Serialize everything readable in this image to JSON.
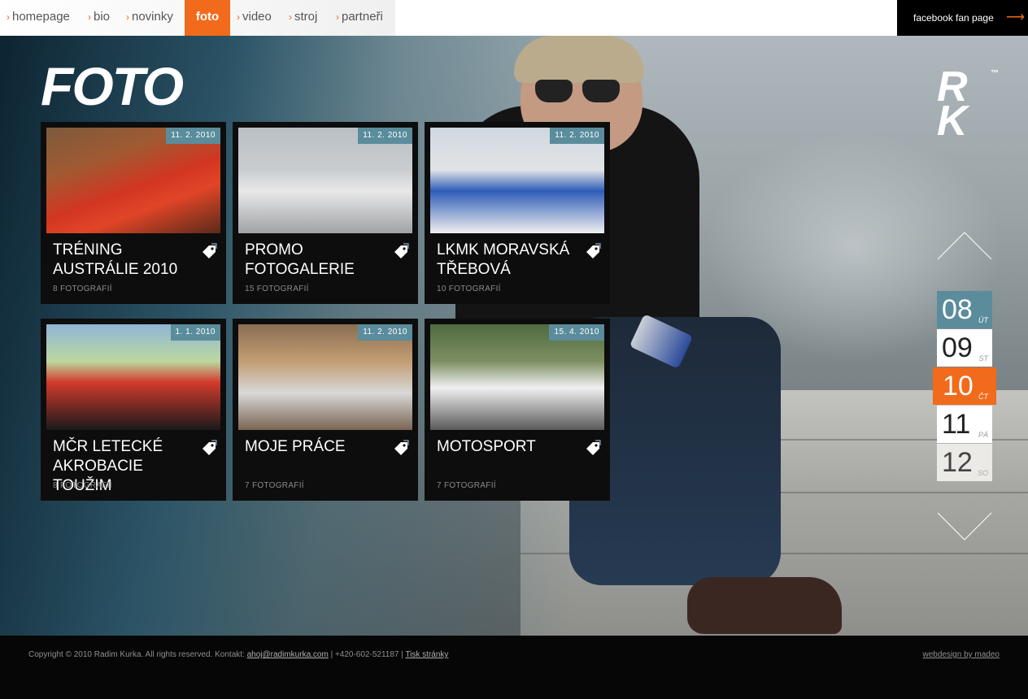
{
  "nav": {
    "items": [
      {
        "label": "homepage",
        "active": false
      },
      {
        "label": "bio",
        "active": false
      },
      {
        "label": "novinky",
        "active": false
      },
      {
        "label": "foto",
        "active": true
      },
      {
        "label": "video",
        "active": false
      },
      {
        "label": "stroj",
        "active": false
      },
      {
        "label": "partneři",
        "active": false
      }
    ],
    "arrow_glyph": "›",
    "facebook_label": "facebook fan page",
    "facebook_icon": "arrow-right-icon"
  },
  "page": {
    "title": "FOTO",
    "logo": "RK",
    "logo_tm": "™"
  },
  "colors": {
    "accent": "#f26a1b",
    "date_badge": "#5a8c9c",
    "card_bg": "#0d0d0d",
    "calendar_highlight": "#5a8c9c"
  },
  "galleries": [
    {
      "date": "11. 2. 2010",
      "title": "TRÉNING AUSTRÁLIE 2010",
      "count": "8 FOTOGRAFIÍ",
      "photo": "red-plane-cockpit",
      "icon": "tag-icon"
    },
    {
      "date": "11. 2. 2010",
      "title": "PROMO FOTOGALERIE",
      "count": "15 FOTOGRAFIÍ",
      "photo": "white-plane-mailstep",
      "icon": "tag-icon"
    },
    {
      "date": "11. 2. 2010",
      "title": "LKMK MORAVSKÁ TŘEBOVÁ",
      "count": "10 FOTOGRAFIÍ",
      "photo": "people-airfield",
      "icon": "tag-icon"
    },
    {
      "date": "1. 1. 2010",
      "title": "MČR LETECKÉ AKROBACIE TOUŽIM",
      "count": "8 FOTOGRAFIÍ",
      "photo": "man-with-plane",
      "icon": "tag-icon"
    },
    {
      "date": "11. 2. 2010",
      "title": "MOJE PRÁCE",
      "count": "7 FOTOGRAFIÍ",
      "photo": "car-showroom",
      "icon": "tag-icon"
    },
    {
      "date": "15. 4. 2010",
      "title": "MOTOSPORT",
      "count": "7 FOTOGRAFIÍ",
      "photo": "formula-car",
      "icon": "tag-icon"
    }
  ],
  "calendar": {
    "up_icon": "chevron-up-icon",
    "down_icon": "chevron-down-icon",
    "days": [
      {
        "num": "08",
        "wd": "ÚT",
        "state": "highlight"
      },
      {
        "num": "09",
        "wd": "ST",
        "state": "normal"
      },
      {
        "num": "10",
        "wd": "ČT",
        "state": "active"
      },
      {
        "num": "11",
        "wd": "PÁ",
        "state": "normal"
      },
      {
        "num": "12",
        "wd": "SO",
        "state": "faded"
      }
    ]
  },
  "footer": {
    "copyright": "Copyright © 2010 Radim Kurka. All rights reserved. Kontakt:",
    "email": "ahoj@radimkurka.com",
    "phone": "| +420-602-521187 |",
    "print_link": "Tisk stránky",
    "credit": "webdesign by madeo"
  }
}
